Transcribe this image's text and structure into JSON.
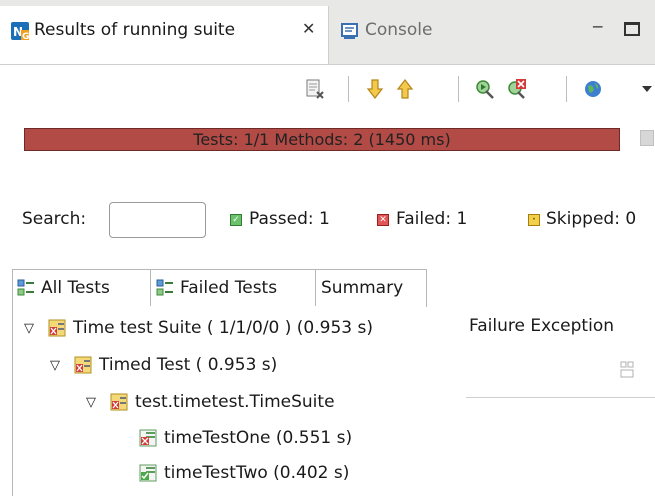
{
  "view_tabs": {
    "active": {
      "title": "Results of running suite",
      "close_glyph": "✕",
      "icon": "testng-icon"
    },
    "other": {
      "title": "Console",
      "icon": "console-icon"
    }
  },
  "window_controls": {
    "minimize_glyph": "‒"
  },
  "toolbar": {
    "buttons": [
      "clear-icon",
      "next-failure-icon",
      "previous-failure-icon",
      "rerun-icon",
      "rerun-failed-icon",
      "web-report-icon"
    ]
  },
  "progress": {
    "text": "Tests: 1/1  Methods: 2 (1450 ms)",
    "fraction": 1.0,
    "color": "#b24a46"
  },
  "search": {
    "label": "Search:",
    "value": "",
    "placeholder": ""
  },
  "stats": {
    "passed": "Passed: 1",
    "failed": "Failed: 1",
    "skipped": "Skipped: 0",
    "passed_color": "#3b9a3b",
    "failed_color": "#c83232",
    "skipped_color": "#d4a017"
  },
  "lower_tabs": [
    "All Tests",
    "Failed Tests",
    "Summary"
  ],
  "tree": [
    {
      "label": "Time test Suite ( 1/1/0/0 ) (0.953 s)",
      "expanded": true,
      "status": "failed"
    },
    {
      "label": "Timed Test ( 0.953 s)",
      "expanded": true,
      "status": "failed"
    },
    {
      "label": "test.timetest.TimeSuite",
      "expanded": true,
      "status": "failed"
    },
    {
      "label": "timeTestOne  (0.551 s)",
      "status": "failed"
    },
    {
      "label": "timeTestTwo  (0.402 s)",
      "status": "passed"
    }
  ],
  "failure_panel": {
    "title": "Failure Exception"
  }
}
